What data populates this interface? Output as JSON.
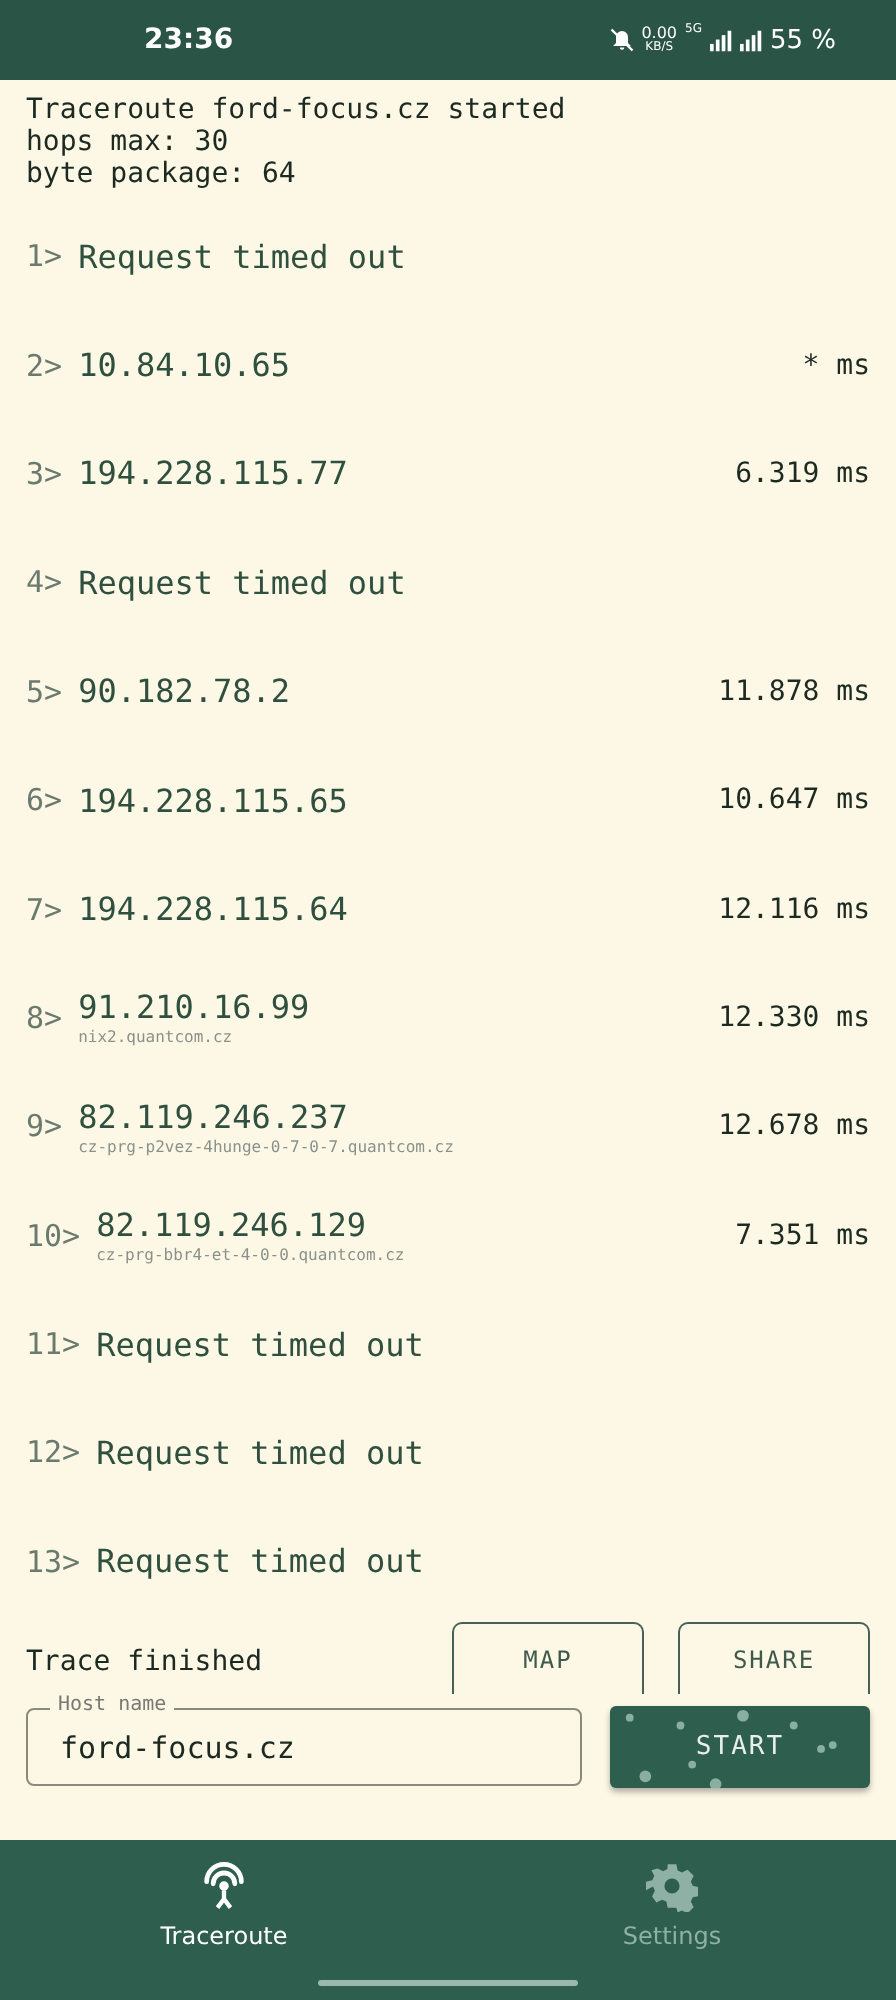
{
  "status_bar": {
    "time": "23:36",
    "speed": "0.00",
    "speed_unit": "KB/S",
    "network": "5G",
    "battery": "55 %"
  },
  "header": [
    "Traceroute ford-focus.cz started",
    "hops max: 30",
    "byte package: 64"
  ],
  "hops": [
    {
      "index": "1>",
      "text": "Request timed out"
    },
    {
      "index": "2>",
      "text": "10.84.10.65",
      "time": "* ms"
    },
    {
      "index": "3>",
      "text": "194.228.115.77",
      "time": "6.319 ms"
    },
    {
      "index": "4>",
      "text": "Request timed out"
    },
    {
      "index": "5>",
      "text": "90.182.78.2",
      "time": "11.878 ms"
    },
    {
      "index": "6>",
      "text": "194.228.115.65",
      "time": "10.647 ms"
    },
    {
      "index": "7>",
      "text": "194.228.115.64",
      "time": "12.116 ms"
    },
    {
      "index": "8>",
      "text": "91.210.16.99",
      "host": "nix2.quantcom.cz",
      "time": "12.330 ms"
    },
    {
      "index": "9>",
      "text": "82.119.246.237",
      "host": "cz-prg-p2vez-4hunge-0-7-0-7.quantcom.cz",
      "time": "12.678 ms"
    },
    {
      "index": "10>",
      "text": "82.119.246.129",
      "host": "cz-prg-bbr4-et-4-0-0.quantcom.cz",
      "time": "7.351 ms"
    },
    {
      "index": "11>",
      "text": "Request timed out"
    },
    {
      "index": "12>",
      "text": "Request timed out"
    },
    {
      "index": "13>",
      "text": "Request timed out"
    }
  ],
  "status": "Trace finished",
  "buttons": [
    "MAP",
    "SHARE"
  ],
  "host_field": {
    "label": "Host name",
    "value": "ford-focus.cz"
  },
  "start_button": "START",
  "nav": [
    {
      "kind": "antenna",
      "label": "Traceroute",
      "selected": true
    },
    {
      "kind": "gear",
      "label": "Settings",
      "selected": false
    }
  ]
}
